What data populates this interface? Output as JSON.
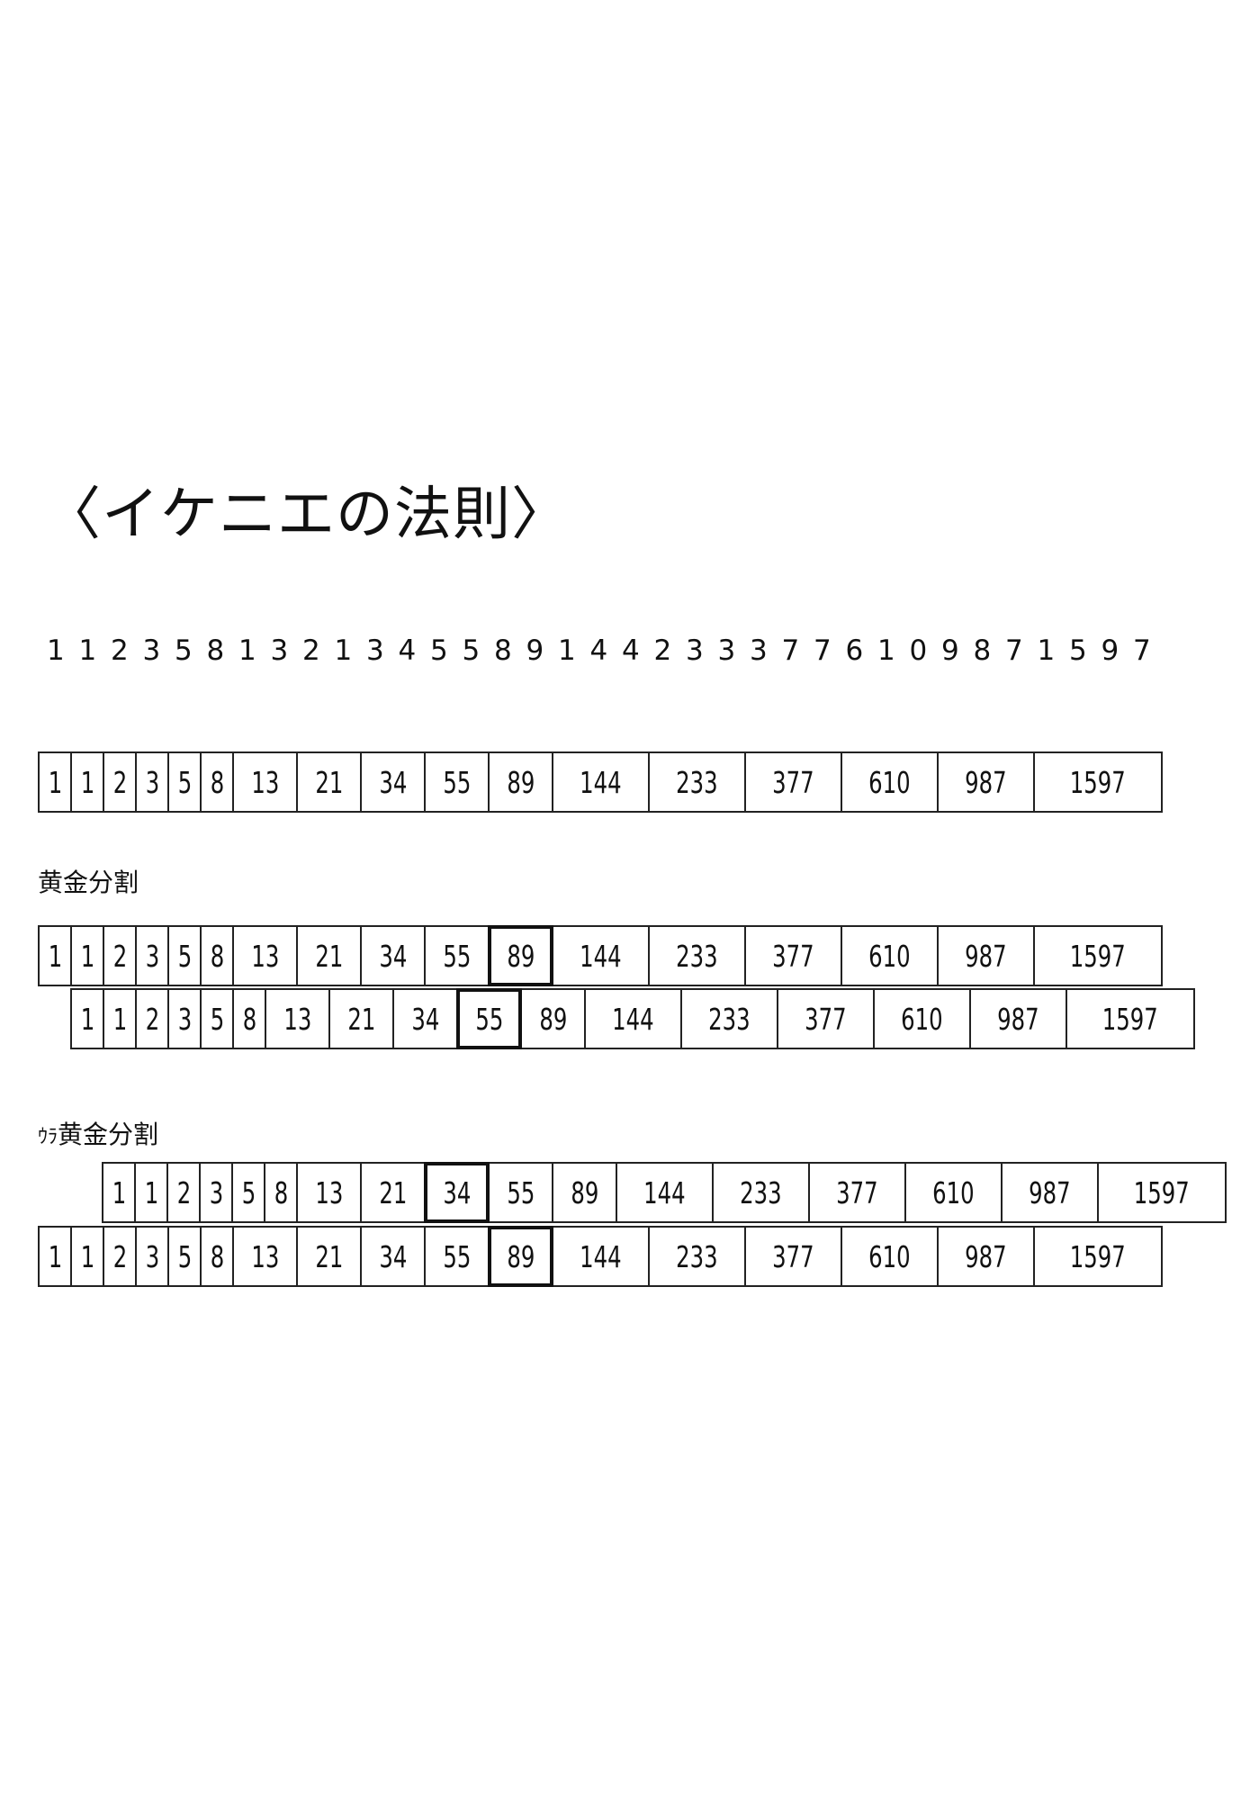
{
  "title": "〈イケニエの法則〉",
  "digit_sequence": [
    "1",
    "1",
    "2",
    "3",
    "5",
    "8",
    "1",
    "3",
    "2",
    "1",
    "3",
    "4",
    "5",
    "5",
    "8",
    "9",
    "1",
    "4",
    "4",
    "2",
    "3",
    "3",
    "3",
    "7",
    "7",
    "6",
    "1",
    "0",
    "9",
    "8",
    "7",
    "1",
    "5",
    "9",
    "7"
  ],
  "labels": {
    "golden": "黄金分割",
    "ura_prefix": "ｳﾗ",
    "ura_main": "黄金分割"
  },
  "strips": [
    {
      "id": "base",
      "values": [
        "1",
        "1",
        "2",
        "3",
        "5",
        "8",
        "13",
        "21",
        "34",
        "55",
        "89",
        "144",
        "233",
        "377",
        "610",
        "987",
        "1597"
      ],
      "highlight_index": -1
    },
    {
      "id": "golden-top",
      "values": [
        "1",
        "1",
        "2",
        "3",
        "5",
        "8",
        "13",
        "21",
        "34",
        "55",
        "89",
        "144",
        "233",
        "377",
        "610",
        "987",
        "1597"
      ],
      "highlight_index": 10
    },
    {
      "id": "golden-bottom",
      "values": [
        "1",
        "1",
        "2",
        "3",
        "5",
        "8",
        "13",
        "21",
        "34",
        "55",
        "89",
        "144",
        "233",
        "377",
        "610",
        "987",
        "1597"
      ],
      "highlight_index": 9
    },
    {
      "id": "ura-top",
      "values": [
        "1",
        "1",
        "2",
        "3",
        "5",
        "8",
        "13",
        "21",
        "34",
        "55",
        "89",
        "144",
        "233",
        "377",
        "610",
        "987",
        "1597"
      ],
      "highlight_index": 8
    },
    {
      "id": "ura-bottom",
      "values": [
        "1",
        "1",
        "2",
        "3",
        "5",
        "8",
        "13",
        "21",
        "34",
        "55",
        "89",
        "144",
        "233",
        "377",
        "610",
        "987",
        "1597"
      ],
      "highlight_index": 10
    }
  ]
}
